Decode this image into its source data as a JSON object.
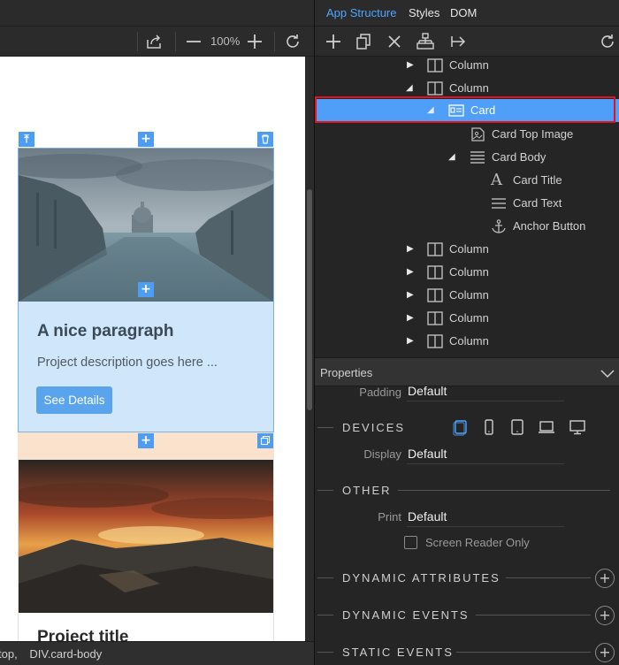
{
  "left_panel": {
    "zoom": "100%",
    "status_path": [
      "top,",
      "DIV.card-body"
    ]
  },
  "canvas": {
    "selected_card": {
      "title": "A nice paragraph",
      "text": "Project description goes here ...",
      "button": "See Details"
    },
    "second_card": {
      "title": "Project title"
    }
  },
  "right_panel": {
    "tabs": [
      {
        "label": "App Structure",
        "active": true
      },
      {
        "label": "Styles",
        "active": false
      },
      {
        "label": "DOM",
        "active": false
      }
    ],
    "tree": [
      {
        "label": "Column",
        "depth": 0,
        "arrow": "collapsed",
        "icon": "column-icon"
      },
      {
        "label": "Column",
        "depth": 0,
        "arrow": "expanded",
        "icon": "column-icon"
      },
      {
        "label": "Card",
        "depth": 1,
        "arrow": "expanded",
        "icon": "card-icon",
        "selected": true
      },
      {
        "label": "Card Top Image",
        "depth": 2,
        "arrow": "none",
        "icon": "image-icon"
      },
      {
        "label": "Card Body",
        "depth": 2,
        "arrow": "expanded",
        "icon": "lines-icon"
      },
      {
        "label": "Card Title",
        "depth": 3,
        "arrow": "none",
        "icon": "text-a-icon"
      },
      {
        "label": "Card Text",
        "depth": 3,
        "arrow": "none",
        "icon": "paragraph-icon"
      },
      {
        "label": "Anchor Button",
        "depth": 3,
        "arrow": "none",
        "icon": "anchor-icon"
      },
      {
        "label": "Column",
        "depth": 0,
        "arrow": "collapsed",
        "icon": "column-icon"
      },
      {
        "label": "Column",
        "depth": 0,
        "arrow": "collapsed",
        "icon": "column-icon"
      },
      {
        "label": "Column",
        "depth": 0,
        "arrow": "collapsed",
        "icon": "column-icon"
      },
      {
        "label": "Column",
        "depth": 0,
        "arrow": "collapsed",
        "icon": "column-icon"
      },
      {
        "label": "Column",
        "depth": 0,
        "arrow": "collapsed",
        "icon": "column-icon"
      }
    ],
    "properties": {
      "title": "Properties",
      "padding_label": "Padding",
      "padding_value": "Default",
      "devices_title": "DEVICES",
      "display_label": "Display",
      "display_value": "Default",
      "other_title": "OTHER",
      "print_label": "Print",
      "print_value": "Default",
      "screen_reader_label": "Screen Reader Only",
      "screen_reader_checked": false,
      "dynamic_attributes_title": "DYNAMIC ATTRIBUTES",
      "dynamic_events_title": "DYNAMIC EVENTS",
      "static_events_title": "STATIC EVENTS"
    }
  },
  "colors": {
    "accent": "#4ea5ff",
    "selection": "#4f9ef8",
    "highlight_outline": "#e0141e",
    "selected_card_bg": "#cfe6fb"
  }
}
